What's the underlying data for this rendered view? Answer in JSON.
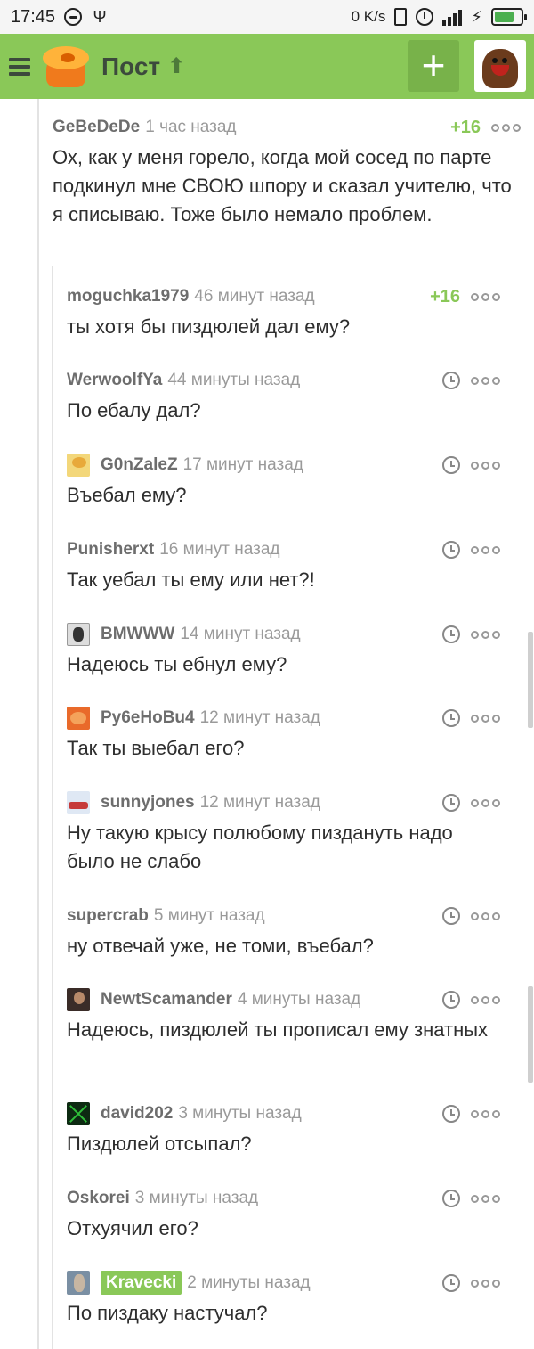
{
  "status_bar": {
    "time": "17:45",
    "speed": "0 K/s",
    "battery_level": 0.75
  },
  "app_bar": {
    "title": "Пост",
    "up_icon": "arrow-up-icon",
    "add_icon": "plus-icon",
    "menu_icon": "hamburger-icon"
  },
  "comments": [
    {
      "user": "GeBeDeDe",
      "time": "1 час назад",
      "rating": "+16",
      "text": "Ох, как у меня горело, когда мой сосед по парте подкинул мне СВОЮ шпору и сказал учителю, что я списываю. Тоже было немало проблем."
    },
    {
      "user": "moguchka1979",
      "time": "46 минут назад",
      "rating": "+16",
      "text": "ты хотя бы пиздюлей дал ему?"
    },
    {
      "user": "WerwoolfYa",
      "time": "44 минуты назад",
      "text": "По ебалу дал?"
    },
    {
      "user": "G0nZaleZ",
      "time": "17 минут назад",
      "text": "Въебал ему?"
    },
    {
      "user": "Punisherxt",
      "time": "16 минут назад",
      "text": "Так уебал ты ему или нет?!"
    },
    {
      "user": "BMWWW",
      "time": "14 минут назад",
      "text": "Надеюсь ты ебнул ему?"
    },
    {
      "user": "Py6eHoBu4",
      "time": "12 минут назад",
      "text": "Так ты выебал его?"
    },
    {
      "user": "sunnyjones",
      "time": "12 минут назад",
      "text": "Ну такую крысу полюбому пиздануть надо было не слабо"
    },
    {
      "user": "supercrab",
      "time": "5 минут назад",
      "text": "ну отвечай уже, не томи, въебал?"
    },
    {
      "user": "NewtScamander",
      "time": "4 минуты назад",
      "text": "Надеюсь, пиздюлей ты прописал ему знатных"
    },
    {
      "user": "david202",
      "time": "3 минуты назад",
      "text": "Пиздюлей отсыпал?"
    },
    {
      "user": "Oskorei",
      "time": "3 минуты назад",
      "text": "Отхуячил его?"
    },
    {
      "user": "Kravecki",
      "time": "2 минуты назад",
      "text": "По пиздаку настучал?"
    }
  ],
  "colors": {
    "brand_green": "#8ac858",
    "rating_green": "#8ac858"
  }
}
